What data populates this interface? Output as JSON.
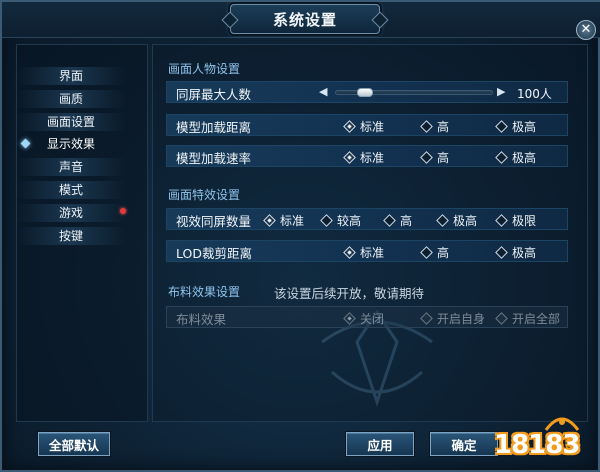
{
  "window": {
    "title": "系统设置",
    "close_icon": "close-icon"
  },
  "sidebar": {
    "items": [
      {
        "label": "界面",
        "active": false,
        "badge": false
      },
      {
        "label": "画质",
        "active": false,
        "badge": false
      },
      {
        "label": "画面设置",
        "active": false,
        "badge": false
      },
      {
        "label": "显示效果",
        "active": true,
        "badge": false
      },
      {
        "label": "声音",
        "active": false,
        "badge": false
      },
      {
        "label": "模式",
        "active": false,
        "badge": false
      },
      {
        "label": "游戏",
        "active": false,
        "badge": true
      },
      {
        "label": "按键",
        "active": false,
        "badge": false
      }
    ]
  },
  "sections": {
    "character": {
      "title": "画面人物设置",
      "max_players": {
        "label": "同屏最大人数",
        "value_text": "100人",
        "slider_fraction": 0.15
      },
      "model_distance": {
        "label": "模型加载距离",
        "options": [
          "标准",
          "高",
          "极高"
        ],
        "selected": 0
      },
      "model_speed": {
        "label": "模型加载速率",
        "options": [
          "标准",
          "高",
          "极高"
        ],
        "selected": 0
      }
    },
    "effects": {
      "title": "画面特效设置",
      "effect_count": {
        "label": "视效同屏数量",
        "options": [
          "标准",
          "较高",
          "高",
          "极高",
          "极限"
        ],
        "selected": 0
      },
      "lod_distance": {
        "label": "LOD裁剪距离",
        "options": [
          "标准",
          "高",
          "极高"
        ],
        "selected": 0
      }
    },
    "cloth": {
      "title": "布料效果设置",
      "note": "该设置后续开放，敬请期待",
      "cloth_effect": {
        "label": "布料效果",
        "options": [
          "关闭",
          "开启自身",
          "开启全部"
        ],
        "selected": 0,
        "disabled": true
      }
    }
  },
  "buttons": {
    "reset_all": "全部默认",
    "apply": "应用",
    "confirm": "确定"
  },
  "logo": {
    "text": "18183"
  },
  "colors": {
    "accent": "#8fc3ec",
    "badge": "#e23a3a",
    "background": "#0e2336"
  }
}
